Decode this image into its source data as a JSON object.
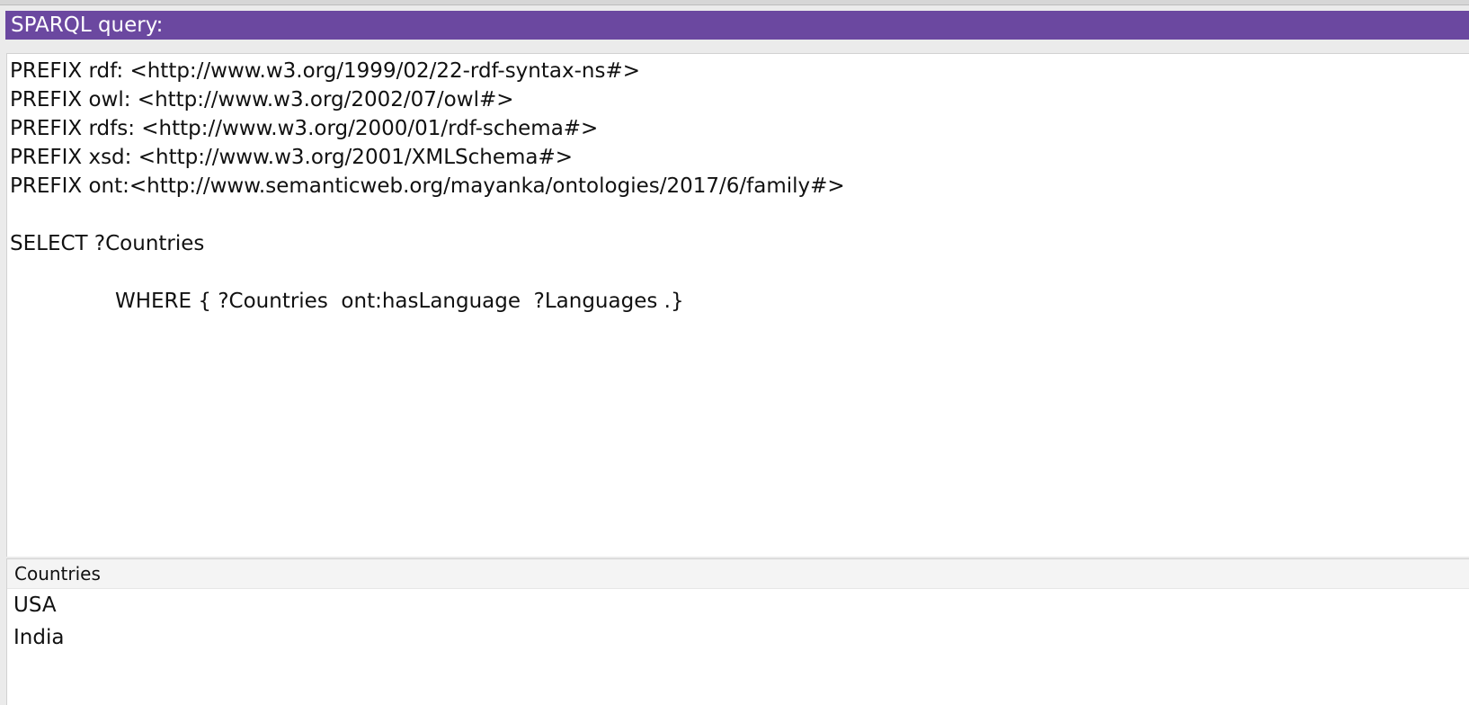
{
  "header": {
    "title": "SPARQL query:"
  },
  "query": {
    "text": "PREFIX rdf: <http://www.w3.org/1999/02/22-rdf-syntax-ns#>\nPREFIX owl: <http://www.w3.org/2002/07/owl#>\nPREFIX rdfs: <http://www.w3.org/2000/01/rdf-schema#>\nPREFIX xsd: <http://www.w3.org/2001/XMLSchema#>\nPREFIX ont:<http://www.semanticweb.org/mayanka/ontologies/2017/6/family#>\n\nSELECT ?Countries\n\n\t\tWHERE { ?Countries  ont:hasLanguage  ?Languages .}"
  },
  "results": {
    "columns": [
      "Countries"
    ],
    "rows": [
      "USA",
      "India"
    ]
  },
  "colors": {
    "header_bg": "#6b48a0",
    "header_text": "#ffffff",
    "panel_bg": "#ffffff",
    "window_bg": "#ebebeb"
  }
}
